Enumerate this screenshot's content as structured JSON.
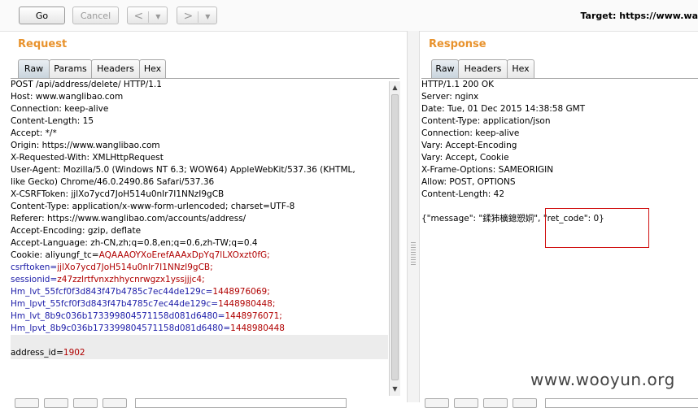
{
  "toolbar": {
    "go_label": "Go",
    "cancel_label": "Cancel",
    "back_glyph": "<",
    "forward_glyph": ">",
    "dropdown_glyph": "▼",
    "target_label": "Target:",
    "target_value": "https://www.wa"
  },
  "request": {
    "title": "Request",
    "tabs": [
      "Raw",
      "Params",
      "Headers",
      "Hex"
    ],
    "active_tab": "Raw",
    "lines": [
      {
        "k": "POST /api/address/delete/ HTTP/1.1",
        "v": ""
      },
      {
        "k": "Host: www.wanglibao.com",
        "v": ""
      },
      {
        "k": "Connection: keep-alive",
        "v": ""
      },
      {
        "k": "Content-Length: 15",
        "v": ""
      },
      {
        "k": "Accept: */*",
        "v": ""
      },
      {
        "k": "Origin: https://www.wanglibao.com",
        "v": ""
      },
      {
        "k": "X-Requested-With: XMLHttpRequest",
        "v": ""
      },
      {
        "k": "User-Agent: Mozilla/5.0 (Windows NT 6.3; WOW64) AppleWebKit/537.36 (KHTML,",
        "v": ""
      },
      {
        "k": "like Gecko) Chrome/46.0.2490.86 Safari/537.36",
        "v": ""
      },
      {
        "k": "X-CSRFToken: jjlXo7ycd7JoH514u0nIr7I1NNzI9gCB",
        "v": ""
      },
      {
        "k": "Content-Type: application/x-www-form-urlencoded; charset=UTF-8",
        "v": ""
      },
      {
        "k": "Referer: https://www.wanglibao.com/accounts/address/",
        "v": ""
      },
      {
        "k": "Accept-Encoding: gzip, deflate",
        "v": ""
      },
      {
        "k": "Accept-Language: zh-CN,zh;q=0.8,en;q=0.6,zh-TW;q=0.4",
        "v": ""
      },
      {
        "k": "Cookie: aliyungf_tc=",
        "v": "AQAAAOYXoErefAAAxDpYq7lLXOxzt0fG;"
      },
      {
        "k": "csrftoken=",
        "v": "jjlXo7ycd7JoH514u0nIr7I1NNzI9gCB;"
      },
      {
        "k": "sessionid=",
        "v": "z47zzlrtfvnxzhhycnrwgzx1yssjjjc4;"
      },
      {
        "k": "Hm_lvt_55fcf0f3d843f47b4785c7ec44de129c=",
        "v": "1448976069;"
      },
      {
        "k": "Hm_lpvt_55fcf0f3d843f47b4785c7ec44de129c=",
        "v": "1448980448;"
      },
      {
        "k": "Hm_lvt_8b9c036b173399804571158d081d6480=",
        "v": "1448976071;"
      },
      {
        "k": "Hm_lpvt_8b9c036b173399804571158d081d6480=",
        "v": "1448980448"
      },
      {
        "k": "",
        "v": ""
      },
      {
        "k": "address_id=",
        "v": "1902"
      }
    ]
  },
  "response": {
    "title": "Response",
    "tabs": [
      "Raw",
      "Headers",
      "Hex"
    ],
    "active_tab": "Raw",
    "lines": [
      "HTTP/1.1 200 OK",
      "Server: nginx",
      "Date: Tue, 01 Dec 2015 14:38:58 GMT",
      "Content-Type: application/json",
      "Connection: keep-alive",
      "Vary: Accept-Encoding",
      "Vary: Accept, Cookie",
      "X-Frame-Options: SAMEORIGIN",
      "Allow: POST, OPTIONS",
      "Content-Length: 42",
      "",
      "{\"message\": \"鍒犻櫎鎴愬姛\", \"ret_code\": 0}"
    ]
  },
  "watermark": "www.wooyun.org",
  "colors": {
    "section_title": "#e8922c",
    "param_value": "#b00000",
    "cookie_key": "#1c1ca8",
    "highlight_box": "#d01010"
  }
}
